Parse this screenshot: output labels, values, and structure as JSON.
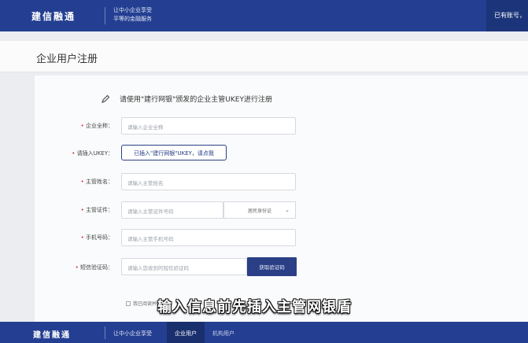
{
  "header": {
    "brand": "建信融通",
    "slogan_line1": "让中小企业享受",
    "slogan_line2": "平等的金融服务",
    "account": "已有账号，"
  },
  "page": {
    "title": "企业用户注册"
  },
  "notice": {
    "text": "请使用\"建行网银\"颁发的企业主管UKEY进行注册",
    "icon": "pen-icon"
  },
  "form": {
    "company_name": {
      "label": "企业全称：",
      "placeholder": "请输入企业全称"
    },
    "ukey": {
      "label": "请插入UKEY：",
      "button": "已插入\"建行网银\"UKEY，请点我"
    },
    "manager_name": {
      "label": "主管姓名：",
      "placeholder": "请输入主管姓名"
    },
    "manager_id": {
      "label": "主管证件：",
      "placeholder": "请输入主管证件号码",
      "id_type": "居民身份证"
    },
    "phone": {
      "label": "手机号码：",
      "placeholder": "请输入主管手机号码"
    },
    "sms": {
      "label": "短信验证码：",
      "placeholder": "请输入您收到的短信验证码",
      "button": "获取验证码"
    },
    "agree_text": "我已阅读并同意"
  },
  "caption": "输入信息前先插入主管网银盾",
  "footer": {
    "brand": "建信融通",
    "slogan": "让中小企业享受",
    "tab_enterprise": "企业用户",
    "tab_institution": "机构用户"
  },
  "colors": {
    "brand_blue": "#243f92",
    "button_blue": "#2a3f86",
    "required_star": "#cc3333"
  }
}
